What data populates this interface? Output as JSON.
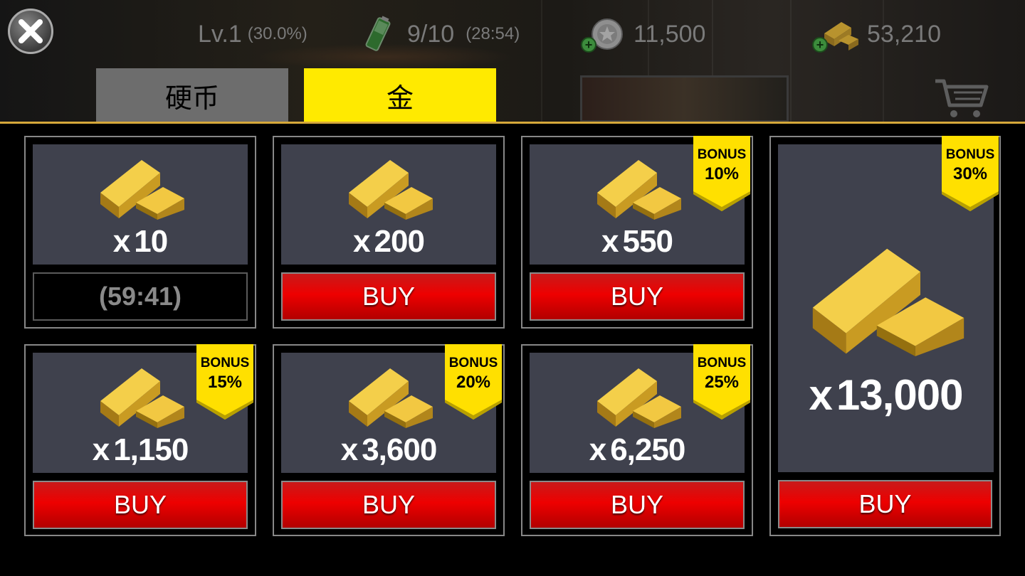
{
  "hud": {
    "level": "Lv.1",
    "level_progress": "(30.0%)",
    "energy": "9/10",
    "energy_timer": "(28:54)",
    "coins": "11,500",
    "gold": "53,210"
  },
  "tabs": [
    {
      "label": "硬币",
      "active": false
    },
    {
      "label": "金",
      "active": true
    }
  ],
  "colors": {
    "accent": "#ffea00",
    "buy_red": "#ee0000",
    "panel": "#3f414d"
  },
  "offers": [
    {
      "x": "x",
      "amount": "10",
      "bonus_top": "",
      "bonus_pct": "",
      "action": "(59:41)",
      "available": false
    },
    {
      "x": "x",
      "amount": "200",
      "bonus_top": "",
      "bonus_pct": "",
      "action": "BUY",
      "available": true
    },
    {
      "x": "x",
      "amount": "550",
      "bonus_top": "BONUS",
      "bonus_pct": "10%",
      "action": "BUY",
      "available": true
    },
    {
      "x": "x",
      "amount": "1,150",
      "bonus_top": "BONUS",
      "bonus_pct": "15%",
      "action": "BUY",
      "available": true
    },
    {
      "x": "x",
      "amount": "3,600",
      "bonus_top": "BONUS",
      "bonus_pct": "20%",
      "action": "BUY",
      "available": true
    },
    {
      "x": "x",
      "amount": "6,250",
      "bonus_top": "BONUS",
      "bonus_pct": "25%",
      "action": "BUY",
      "available": true
    },
    {
      "x": "x",
      "amount": "13,000",
      "bonus_top": "BONUS",
      "bonus_pct": "30%",
      "action": "BUY",
      "available": true
    }
  ]
}
